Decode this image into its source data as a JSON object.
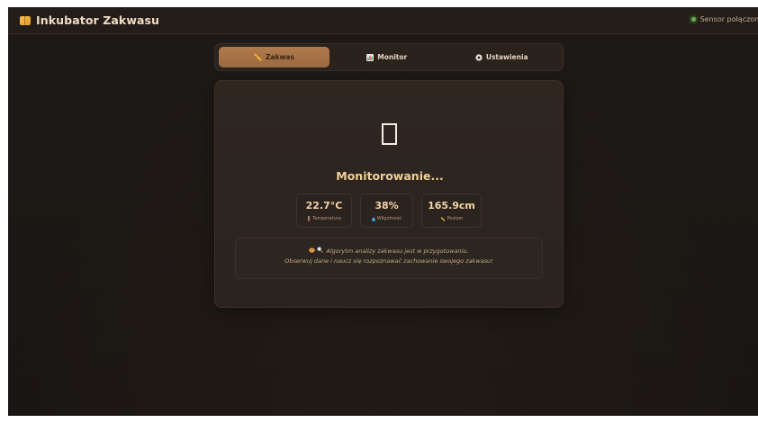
{
  "app": {
    "title": "Inkubator Zakwasu",
    "icon": "notebook-icon"
  },
  "status": {
    "sensor_label": "Sensor połączony",
    "sensor_color": "#5fb24a"
  },
  "tabs": [
    {
      "label": "Zakwas",
      "icon": "ruler-icon",
      "active": true
    },
    {
      "label": "Monitor",
      "icon": "bar-chart-icon",
      "active": false
    },
    {
      "label": "Ustawienia",
      "icon": "gear-icon",
      "active": false
    }
  ],
  "main": {
    "placeholder_icon": "missing-glyph-icon",
    "heading": "Monitorowanie...",
    "stats": [
      {
        "value": "22.7°C",
        "label": "Temperatura",
        "icon": "thermometer-icon"
      },
      {
        "value": "38%",
        "label": "Wilgotność",
        "icon": "droplet-icon"
      },
      {
        "value": "165.9cm",
        "label": "Poziom",
        "icon": "ruler-icon"
      }
    ],
    "note": {
      "line1": "Algorytm analizy zakwasu jest w przygotowaniu.",
      "line2": "Obserwuj dane i naucz się rozpoznawać zachowanie swojego zakwasu!",
      "icons": [
        "bread-icon",
        "magnifier-icon"
      ]
    }
  },
  "colors": {
    "accent": "#f0cf98",
    "active_tab": "#b07a4c",
    "background": "#1d1916"
  }
}
